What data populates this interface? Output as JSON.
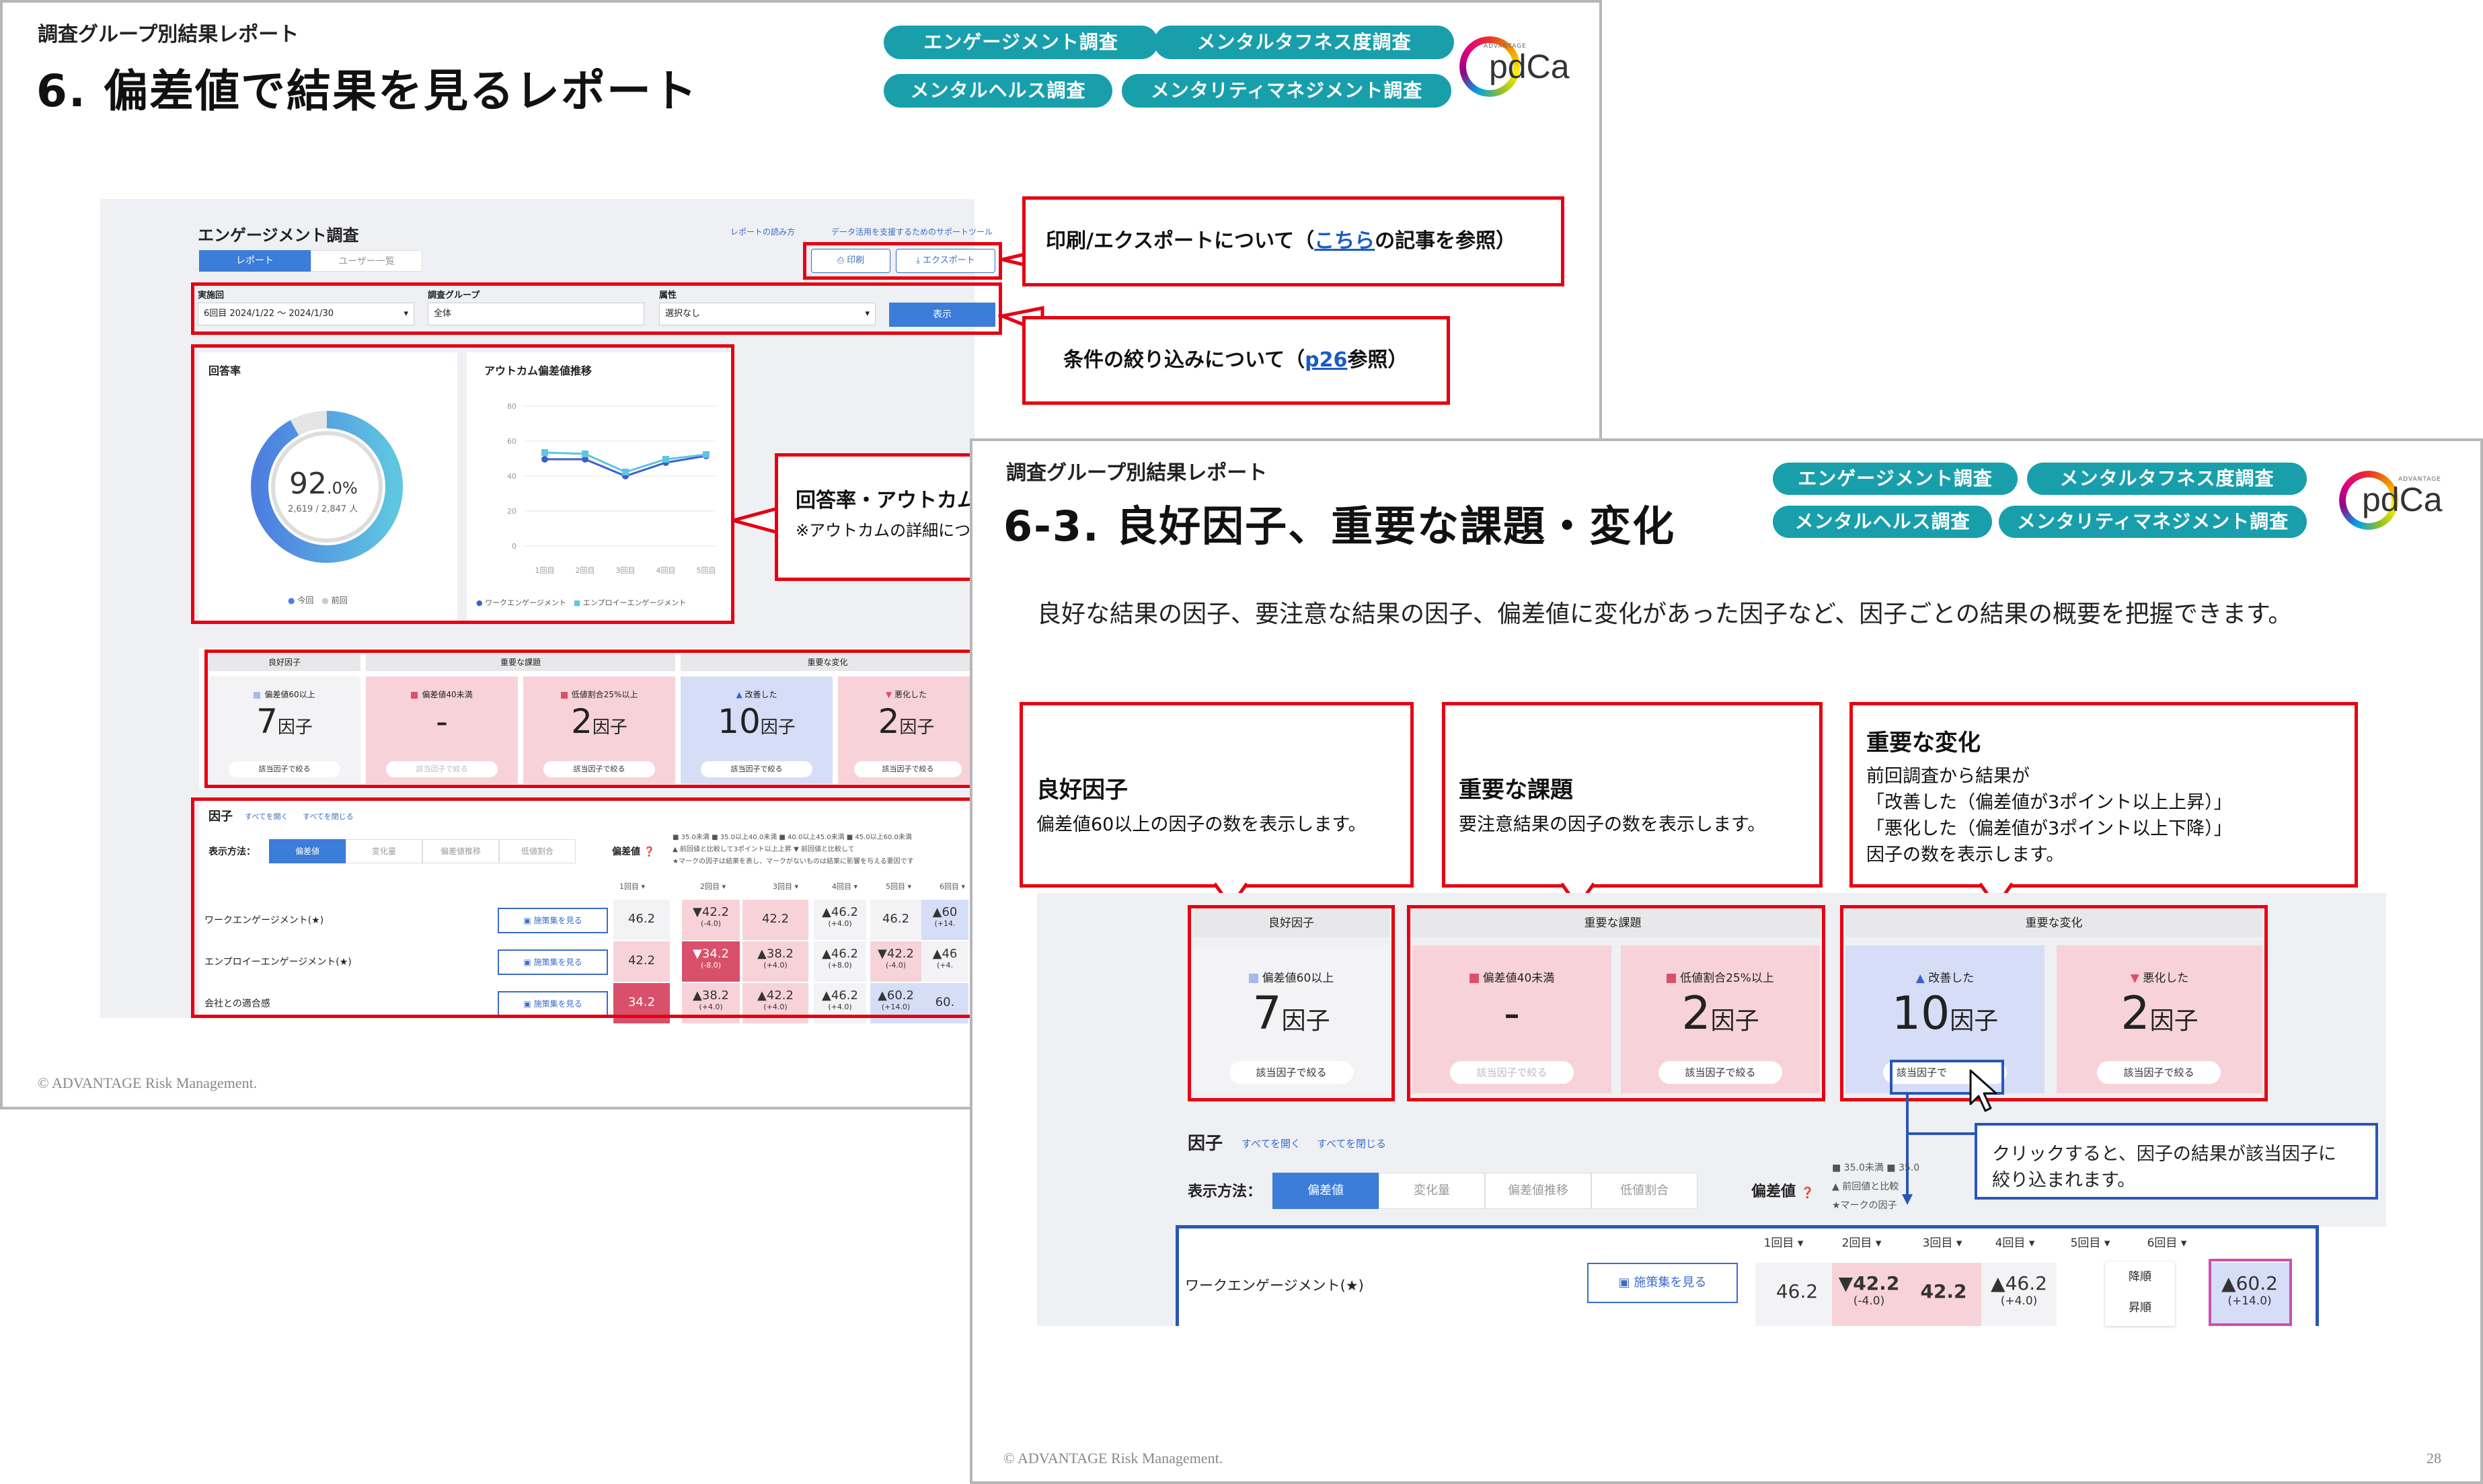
{
  "slide1": {
    "subtitle": "調査グループ別結果レポート",
    "title": "6. 偏差値で結果を見るレポート",
    "pills": [
      "エンゲージメント調査",
      "メンタルタフネス度調査",
      "メンタルヘルス調査",
      "メンタリティマネジメント調査"
    ],
    "logo": {
      "small": "ADVANTAGE",
      "text": "pdCa"
    },
    "footer": "© ADVANTAGE Risk Management.",
    "screen": {
      "heading": "エンゲージメント調査",
      "tabs": [
        "レポート",
        "ユーザー一覧"
      ],
      "links": [
        "レポートの読み方",
        "データ活用を支援するためのサポートツール"
      ],
      "print": "印刷",
      "export": "エクスポート",
      "filters": {
        "round_label": "実施回",
        "round_value": "6回目 2024/1/22 ～ 2024/1/30",
        "group_label": "調査グループ",
        "group_value": "全体",
        "attr_label": "属性",
        "attr_value": "選択なし",
        "show": "表示"
      },
      "response": {
        "label": "回答率",
        "value": "92",
        "unit": ".0%",
        "sub": "2,619 / 2,847 人",
        "legend": [
          "今回",
          "前回"
        ],
        "rate": 0.92
      },
      "outcome": {
        "label": "アウトカム偏差値推移",
        "yticks": [
          "80",
          "60",
          "40",
          "20",
          "0"
        ],
        "xticks": [
          "1回目",
          "2回目",
          "3回目",
          "4回目",
          "5回目"
        ],
        "legend": [
          "ワークエンゲージメント",
          "エンプロイーエンゲージメント"
        ]
      },
      "summary": {
        "groups": [
          "良好因子",
          "重要な課題",
          "重要な変化"
        ],
        "boxes": [
          {
            "label": "偏差値60以上",
            "value": "7",
            "unit": "因子",
            "btn": "該当因子で絞る"
          },
          {
            "label": "偏差値40未満",
            "value": "-",
            "unit": "",
            "btn": "該当因子で絞る"
          },
          {
            "label": "低値割合25%以上",
            "value": "2",
            "unit": "因子",
            "btn": "該当因子で絞る"
          },
          {
            "label": "改善した",
            "value": "10",
            "unit": "因子",
            "btn": "該当因子で絞る"
          },
          {
            "label": "悪化した",
            "value": "2",
            "unit": "因子",
            "btn": "該当因子で絞る"
          }
        ]
      },
      "factors": {
        "label": "因子",
        "open": "すべてを開く",
        "close": "すべてを閉じる",
        "method": "表示方法：",
        "modes": [
          "偏差値",
          "変化量",
          "偏差値推移",
          "低値割合"
        ],
        "dev": "偏差値",
        "legend1": "■ 35.0未満 ■ 35.0以上40.0未満 ■ 40.0以上45.0未満 ■ 45.0以上60.0未満",
        "legend2": "▲ 前回値と比較して3ポイント以上上昇 ▼ 前回値と比較して",
        "legend3": "★マークの因子は結果を表し、マークがないものは結果に影響を与える要因です",
        "rounds": [
          "1回目",
          "2回目",
          "3回目",
          "4回目",
          "5回目",
          "6回目"
        ],
        "rows": [
          {
            "name": "ワークエンゲージメント(★)",
            "btn": "施策集を見る",
            "cells": [
              {
                "v": "46.2",
                "d": ""
              },
              {
                "v": "▼42.2",
                "d": "(-4.0)"
              },
              {
                "v": "42.2",
                "d": ""
              },
              {
                "v": "▲46.2",
                "d": "(+4.0)"
              },
              {
                "v": "46.2",
                "d": ""
              },
              {
                "v": "▲60",
                "d": "(+14."
              }
            ]
          },
          {
            "name": "エンプロイーエンゲージメント(★)",
            "btn": "施策集を見る",
            "cells": [
              {
                "v": "42.2",
                "d": ""
              },
              {
                "v": "▼34.2",
                "d": "(-8.0)"
              },
              {
                "v": "▲38.2",
                "d": "(+4.0)"
              },
              {
                "v": "▲46.2",
                "d": "(+8.0)"
              },
              {
                "v": "▼42.2",
                "d": "(-4.0)"
              },
              {
                "v": "▲46",
                "d": "(+4."
              }
            ]
          },
          {
            "name": "会社との適合感",
            "btn": "施策集を見る",
            "cells": [
              {
                "v": "34.2",
                "d": ""
              },
              {
                "v": "▲38.2",
                "d": "(+4.0)"
              },
              {
                "v": "▲42.2",
                "d": "(+4.0)"
              },
              {
                "v": "▲46.2",
                "d": "(+4.0)"
              },
              {
                "v": "▲60.2",
                "d": "(+14.0)"
              },
              {
                "v": "60.",
                "d": ""
              }
            ]
          }
        ]
      }
    },
    "callouts": {
      "print_pre": "印刷/エクスポートについて（",
      "print_link": "こちら",
      "print_post": "の記事を参照）",
      "filter_pre": "条件の絞り込みについて（",
      "filter_link": "p26",
      "filter_post": "参照）",
      "response_line1": "回答率・アウトカム",
      "response_line2": "※アウトカムの詳細につ"
    }
  },
  "slide2": {
    "subtitle": "調査グループ別結果レポート",
    "title": "6-3. 良好因子、重要な課題・変化",
    "pills": [
      "エンゲージメント調査",
      "メンタルタフネス度調査",
      "メンタルヘルス調査",
      "メンタリティマネジメント調査"
    ],
    "logo": {
      "small": "ADVANTAGE",
      "text": "pdCa"
    },
    "description": "良好な結果の因子、要注意な結果の因子、偏差値に変化があった因子など、因子ごとの結果の概要を把握できます。",
    "callouts": [
      {
        "title": "良好因子",
        "lines": [
          "偏差値60以上の因子の数を表示します。"
        ]
      },
      {
        "title": "重要な課題",
        "lines": [
          "要注意結果の因子の数を表示します。"
        ]
      },
      {
        "title": "重要な変化",
        "lines": [
          "前回調査から結果が",
          "「改善した（偏差値が3ポイント以上上昇）」",
          "「悪化した（偏差値が3ポイント以上下降）」",
          "因子の数を表示します。"
        ]
      }
    ],
    "summary": {
      "groups": [
        "良好因子",
        "重要な課題",
        "重要な変化"
      ],
      "boxes": [
        {
          "label": "偏差値60以上",
          "value": "7",
          "unit": "因子",
          "btn": "該当因子で絞る"
        },
        {
          "label": "偏差値40未満",
          "value": "-",
          "unit": "",
          "btn": "該当因子で絞る"
        },
        {
          "label": "低値割合25%以上",
          "value": "2",
          "unit": "因子",
          "btn": "該当因子で絞る"
        },
        {
          "label": "改善した",
          "value": "10",
          "unit": "因子",
          "btn": "該当因子で"
        },
        {
          "label": "悪化した",
          "value": "2",
          "unit": "因子",
          "btn": "該当因子で絞る"
        }
      ]
    },
    "click_note": [
      "クリックすると、因子の結果が該当因子に",
      "絞り込まれます。"
    ],
    "factors": {
      "label": "因子",
      "open": "すべてを開く",
      "close": "すべてを閉じる",
      "method": "表示方法：",
      "modes": [
        "偏差値",
        "変化量",
        "偏差値推移",
        "低値割合"
      ],
      "dev": "偏差値",
      "legend1": "■ 35.0未満 ■ 35.0",
      "legend2": "▲ 前回値と比較",
      "legend3": "★マークの因子",
      "rounds": [
        "1回目",
        "2回目",
        "3回目",
        "4回目",
        "5回目",
        "6回目"
      ],
      "row_name": "ワークエンゲージメント(★)",
      "row_btn": "施策集を見る",
      "cells": [
        {
          "v": "46.2",
          "d": ""
        },
        {
          "v": "▼42.2",
          "d": "(-4.0)"
        },
        {
          "v": "42.2",
          "d": ""
        },
        {
          "v": "▲46.2",
          "d": "(+4.0)"
        },
        {
          "v": "",
          "d": ""
        },
        {
          "v": "▲60.2",
          "d": "(+14.0)"
        }
      ],
      "sort": [
        "降順",
        "昇順"
      ]
    },
    "footer": "© ADVANTAGE Risk Management.",
    "page": "28"
  }
}
